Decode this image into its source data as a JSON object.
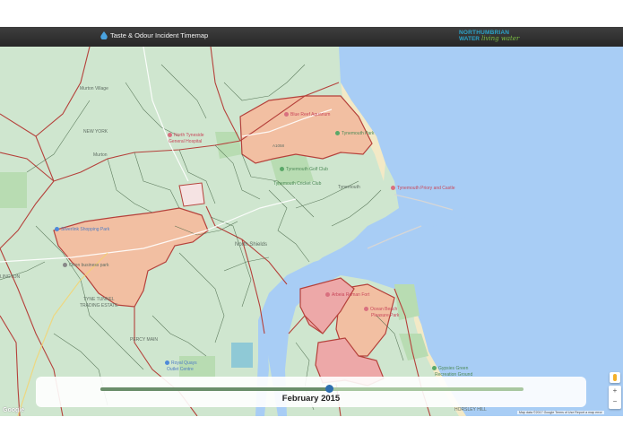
{
  "header": {
    "title": "Taste & Odour Incident Timemap",
    "logo": {
      "line1": "NORTHUMBRIAN",
      "line2": "WATER",
      "line3": "living water"
    }
  },
  "timeline": {
    "label": "February 2015",
    "progress": 0.54
  },
  "map": {
    "labels": {
      "north_tyneside_hospital_1": "North Tyneside",
      "north_tyneside_hospital_2": "General Hospital",
      "new_york": "NEW YORK",
      "murton": "Murton",
      "murton_village": "Murton Village",
      "blue_reef": "Blue Reef Aquarium",
      "tynemouth_park": "Tynemouth Park",
      "a1058": "A1058",
      "tynemouth_golf": "Tynemouth Golf Club",
      "tynemouth_cricket": "Tynemouth Cricket Club",
      "tynemouth": "Tynemouth",
      "priory_castle": "Tynemouth Priory and Castle",
      "silverlink": "Silverlink Shopping Park",
      "orion": "Orion business park",
      "tyne_tunnel": "TYNE TUNNEL",
      "trading_estate": "TRADING ESTATE",
      "north_shields": "North Shields",
      "arbeia": "Arbeia Roman Fort",
      "ocean_beach_1": "Ocean Beach",
      "ocean_beach_2": "Pleasure Park",
      "royal_quays_1": "Royal Quays",
      "royal_quays_2": "Outlet Centre",
      "percy_main": "PERCY MAIN",
      "gypsies_green_1": "Gypsies Green",
      "gypsies_green_2": "Recreation Ground",
      "horsley_hill": "HORSLEY HILL",
      "wallsend": "LINGTON",
      "colors": {
        "water": "#a8cdf5",
        "area": "#cfe6cf",
        "orange": "#f2bfa2",
        "red": "#eda8a8",
        "boundary_red": "#b5413b",
        "boundary_dark": "#2f4a2f"
      }
    },
    "zoom_in": "+",
    "zoom_out": "−",
    "google": "Google",
    "attribution": "Map data ©2017 Google   Terms of Use   Report a map error"
  }
}
